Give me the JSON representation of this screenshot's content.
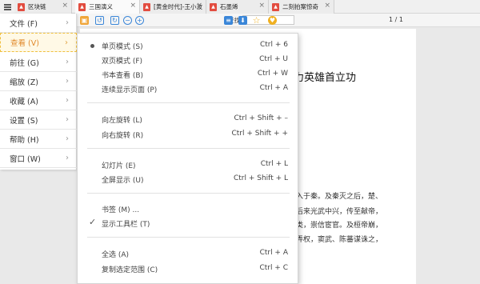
{
  "tabs": [
    {
      "label": "区块链",
      "close": "×"
    },
    {
      "label": "三国演义",
      "close": "×"
    },
    {
      "label": "[黄金时代]-王小波",
      "close": "×"
    },
    {
      "label": "石墨烯",
      "close": "×"
    },
    {
      "label": "二刻拍案惊奇",
      "close": "×"
    }
  ],
  "toolbar": {
    "find_label": "查找:",
    "find_value": "",
    "page_indicator": "1 / 1",
    "icons": [
      "open-file-icon",
      "rotate-left-icon",
      "rotate-right-icon",
      "zoom-out-icon",
      "zoom-in-icon",
      "doc-icon",
      "save-icon",
      "star-icon",
      "heart-icon"
    ]
  },
  "sidebar": {
    "items": [
      {
        "label": "文件 (F)"
      },
      {
        "label": "查看 (V)"
      },
      {
        "label": "前往 (G)"
      },
      {
        "label": "缩放 (Z)"
      },
      {
        "label": "收藏 (A)"
      },
      {
        "label": "设置 (S)"
      },
      {
        "label": "帮助 (H)"
      },
      {
        "label": "窗口 (W)"
      }
    ],
    "chevron": "›"
  },
  "submenu": {
    "items": [
      {
        "label": "单页模式 (S)",
        "shortcut": "Ctrl + 6"
      },
      {
        "label": "双页模式 (F)",
        "shortcut": "Ctrl + U"
      },
      {
        "label": "书本查看 (B)",
        "shortcut": "Ctrl + W"
      },
      {
        "label": "连续显示页面 (P)",
        "shortcut": "Ctrl + A"
      },
      {
        "label": "向左旋转 (L)",
        "shortcut": "Ctrl + Shift + –"
      },
      {
        "label": "向右旋转 (R)",
        "shortcut": "Ctrl + Shift + +"
      },
      {
        "label": "幻灯片 (E)",
        "shortcut": "Ctrl + L"
      },
      {
        "label": "全屏显示 (U)",
        "shortcut": "Ctrl + Shift + L"
      },
      {
        "label": "书签 (M) ...",
        "shortcut": ""
      },
      {
        "label": "显示工具栏 (T)",
        "shortcut": ""
      },
      {
        "label": "全选 (A)",
        "shortcut": "Ctrl + A"
      },
      {
        "label": "复制选定范围 (C)",
        "shortcut": "Ctrl + C"
      }
    ],
    "check_glyph": "✓"
  },
  "document": {
    "title_fragment": "力英雄首立功",
    "lines": [
      "入于秦。及秦灭之后，楚、",
      "后来光武中兴，传至献帝，",
      "类，崇信宦官。及桓帝崩，",
      "弄权，窦武、陈蕃谋诛之，"
    ]
  },
  "colors": {
    "accent": "#e0892a",
    "pdf_red": "#e24c3f"
  }
}
